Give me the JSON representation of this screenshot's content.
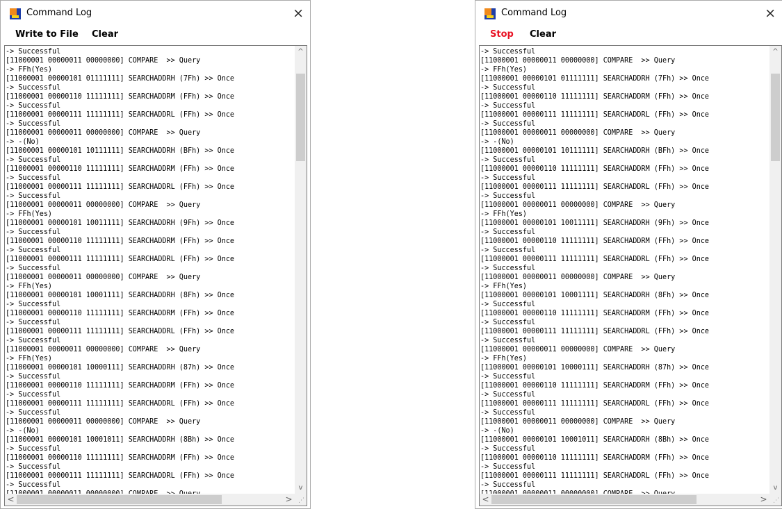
{
  "windows": [
    {
      "title": "Command Log",
      "close_glyph": "×",
      "buttons": [
        "Write to File",
        "Clear"
      ],
      "log": [
        "-> Successful",
        "[11000001 00000011 00000000] COMPARE  >> Query",
        "-> FFh(Yes)",
        "[11000001 00000101 01111111] SEARCHADDRH (7Fh) >> Once",
        "-> Successful",
        "[11000001 00000110 11111111] SEARCHADDRM (FFh) >> Once",
        "-> Successful",
        "[11000001 00000111 11111111] SEARCHADDRL (FFh) >> Once",
        "-> Successful",
        "[11000001 00000011 00000000] COMPARE  >> Query",
        "-> -(No)",
        "[11000001 00000101 10111111] SEARCHADDRH (BFh) >> Once",
        "-> Successful",
        "[11000001 00000110 11111111] SEARCHADDRM (FFh) >> Once",
        "-> Successful",
        "[11000001 00000111 11111111] SEARCHADDRL (FFh) >> Once",
        "-> Successful",
        "[11000001 00000011 00000000] COMPARE  >> Query",
        "-> FFh(Yes)",
        "[11000001 00000101 10011111] SEARCHADDRH (9Fh) >> Once",
        "-> Successful",
        "[11000001 00000110 11111111] SEARCHADDRM (FFh) >> Once",
        "-> Successful",
        "[11000001 00000111 11111111] SEARCHADDRL (FFh) >> Once",
        "-> Successful",
        "[11000001 00000011 00000000] COMPARE  >> Query",
        "-> FFh(Yes)",
        "[11000001 00000101 10001111] SEARCHADDRH (8Fh) >> Once",
        "-> Successful",
        "[11000001 00000110 11111111] SEARCHADDRM (FFh) >> Once",
        "-> Successful",
        "[11000001 00000111 11111111] SEARCHADDRL (FFh) >> Once",
        "-> Successful",
        "[11000001 00000011 00000000] COMPARE  >> Query",
        "-> FFh(Yes)",
        "[11000001 00000101 10000111] SEARCHADDRH (87h) >> Once",
        "-> Successful",
        "[11000001 00000110 11111111] SEARCHADDRM (FFh) >> Once",
        "-> Successful",
        "[11000001 00000111 11111111] SEARCHADDRL (FFh) >> Once",
        "-> Successful",
        "[11000001 00000011 00000000] COMPARE  >> Query",
        "-> -(No)",
        "[11000001 00000101 10001011] SEARCHADDRH (8Bh) >> Once",
        "-> Successful",
        "[11000001 00000110 11111111] SEARCHADDRM (FFh) >> Once",
        "-> Successful",
        "[11000001 00000111 11111111] SEARCHADDRL (FFh) >> Once",
        "-> Successful",
        "[11000001 00000011 00000000] COMPARE  >> Query"
      ]
    },
    {
      "title": "Command Log",
      "close_glyph": "×",
      "buttons": [
        "Stop",
        "Clear"
      ],
      "log": [
        "-> Successful",
        "[11000001 00000011 00000000] COMPARE  >> Query",
        "-> FFh(Yes)",
        "[11000001 00000101 01111111] SEARCHADDRH (7Fh) >> Once",
        "-> Successful",
        "[11000001 00000110 11111111] SEARCHADDRM (FFh) >> Once",
        "-> Successful",
        "[11000001 00000111 11111111] SEARCHADDRL (FFh) >> Once",
        "-> Successful",
        "[11000001 00000011 00000000] COMPARE  >> Query",
        "-> -(No)",
        "[11000001 00000101 10111111] SEARCHADDRH (BFh) >> Once",
        "-> Successful",
        "[11000001 00000110 11111111] SEARCHADDRM (FFh) >> Once",
        "-> Successful",
        "[11000001 00000111 11111111] SEARCHADDRL (FFh) >> Once",
        "-> Successful",
        "[11000001 00000011 00000000] COMPARE  >> Query",
        "-> FFh(Yes)",
        "[11000001 00000101 10011111] SEARCHADDRH (9Fh) >> Once",
        "-> Successful",
        "[11000001 00000110 11111111] SEARCHADDRM (FFh) >> Once",
        "-> Successful",
        "[11000001 00000111 11111111] SEARCHADDRL (FFh) >> Once",
        "-> Successful",
        "[11000001 00000011 00000000] COMPARE  >> Query",
        "-> FFh(Yes)",
        "[11000001 00000101 10001111] SEARCHADDRH (8Fh) >> Once",
        "-> Successful",
        "[11000001 00000110 11111111] SEARCHADDRM (FFh) >> Once",
        "-> Successful",
        "[11000001 00000111 11111111] SEARCHADDRL (FFh) >> Once",
        "-> Successful",
        "[11000001 00000011 00000000] COMPARE  >> Query",
        "-> FFh(Yes)",
        "[11000001 00000101 10000111] SEARCHADDRH (87h) >> Once",
        "-> Successful",
        "[11000001 00000110 11111111] SEARCHADDRM (FFh) >> Once",
        "-> Successful",
        "[11000001 00000111 11111111] SEARCHADDRL (FFh) >> Once",
        "-> Successful",
        "[11000001 00000011 00000000] COMPARE  >> Query",
        "-> -(No)",
        "[11000001 00000101 10001011] SEARCHADDRH (8Bh) >> Once",
        "-> Successful",
        "[11000001 00000110 11111111] SEARCHADDRM (FFh) >> Once",
        "-> Successful",
        "[11000001 00000111 11111111] SEARCHADDRL (FFh) >> Once",
        "-> Successful",
        "[11000001 00000011 00000000] COMPARE  >> Query"
      ]
    }
  ],
  "scroll_glyphs": {
    "up": "^",
    "down": "v",
    "left": "<",
    "right": ">"
  },
  "colors": {
    "stop": "#e81123",
    "icon_blue": "#1e3fa8",
    "icon_orange": "#f08a1c",
    "icon_yellow": "#f6d21a"
  },
  "icons": {
    "app": "app-logo-icon",
    "close": "close-icon"
  }
}
